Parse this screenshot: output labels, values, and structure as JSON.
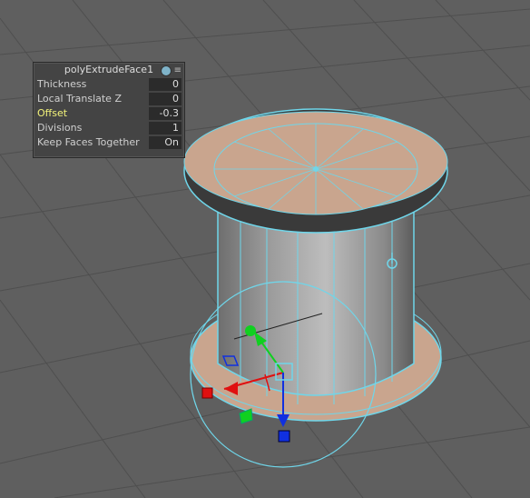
{
  "attribute_panel": {
    "title": "polyExtrudeFace1",
    "info_icon": "info-icon",
    "menu_icon": "menu-lines-icon",
    "rows": [
      {
        "label": "Thickness",
        "value": "0"
      },
      {
        "label": "Local Translate Z",
        "value": "0"
      },
      {
        "label": "Offset",
        "value": "-0.3",
        "highlighted": true
      },
      {
        "label": "Divisions",
        "value": "1"
      },
      {
        "label": "Keep Faces Together",
        "value": "On"
      }
    ]
  },
  "colors": {
    "viewport_background": "#5f5f5f",
    "grid_line": "#4d4d4d",
    "wireframe": "#6fd6ea",
    "selected_face_fill": "#c9a58e",
    "label_highlight": "#f3f37a"
  },
  "manipulator": {
    "axis_x_color": "#e01010",
    "axis_y_color": "#10d020",
    "axis_z_color": "#1030e0"
  }
}
